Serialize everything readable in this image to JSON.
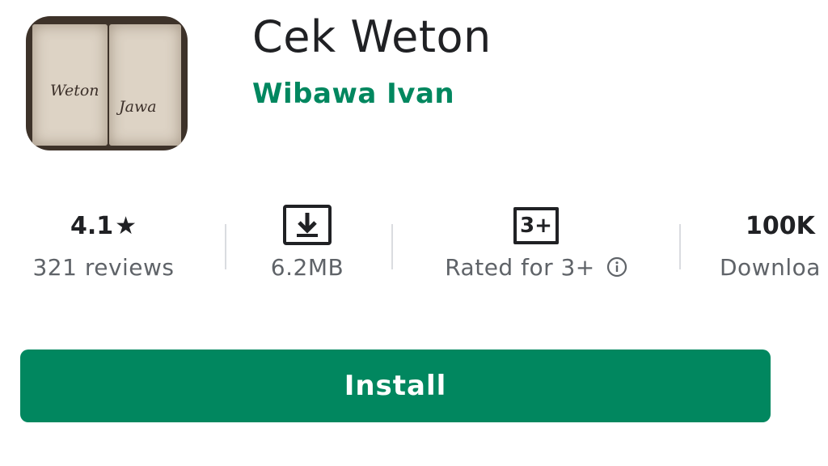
{
  "app": {
    "title": "Cek Weton",
    "developer": "Wibawa Ivan",
    "icon": {
      "name": "book-icon",
      "word_left": "Weton",
      "word_right": "Jawa"
    }
  },
  "stats": {
    "rating": {
      "value": "4.1",
      "star": "★",
      "label": "321 reviews"
    },
    "size": {
      "icon": "download-icon",
      "label": "6.2MB"
    },
    "age": {
      "badge": "3+",
      "label": "Rated for 3+",
      "info_icon": "info-icon"
    },
    "downloads": {
      "value": "100K",
      "label": "Downloa"
    }
  },
  "install": {
    "label": "Install"
  },
  "colors": {
    "accent": "#01875f",
    "title": "#202124",
    "secondary": "#5f6368",
    "divider": "#dadce0"
  }
}
